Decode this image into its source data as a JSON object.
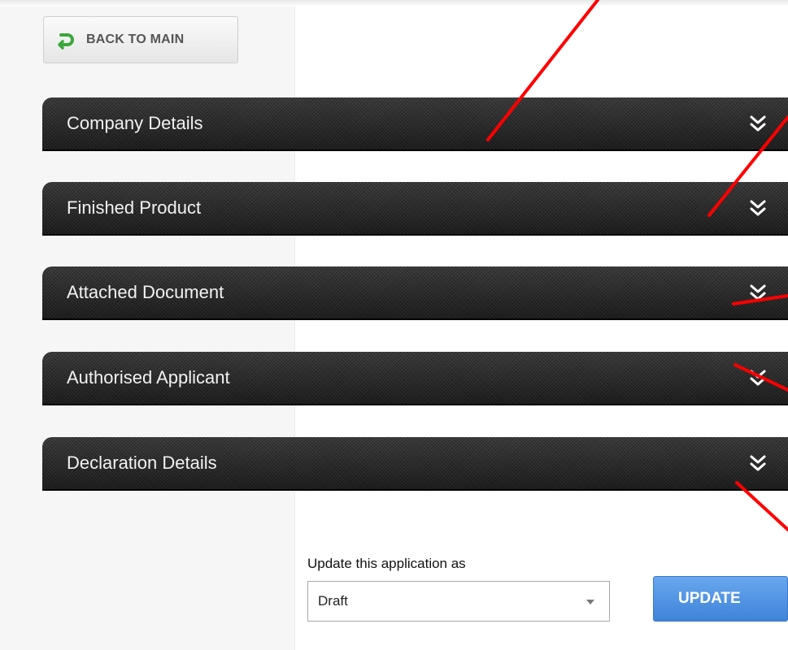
{
  "back_button": {
    "label": "BACK TO MAIN",
    "icon": "back-arrow-icon",
    "icon_color": "#3aa73a"
  },
  "panels": [
    {
      "title": "Company Details",
      "icon": "double-chevron-down-icon"
    },
    {
      "title": "Finished Product",
      "icon": "double-chevron-down-icon"
    },
    {
      "title": "Attached Document",
      "icon": "double-chevron-down-icon"
    },
    {
      "title": "Authorised Applicant",
      "icon": "double-chevron-down-icon"
    },
    {
      "title": "Declaration Details",
      "icon": "double-chevron-down-icon"
    }
  ],
  "status": {
    "label": "Update this application as",
    "selected": "Draft"
  },
  "update_button": {
    "label": "UPDATE",
    "color": "#4a90e2"
  },
  "annotation_color": "#ff0000"
}
